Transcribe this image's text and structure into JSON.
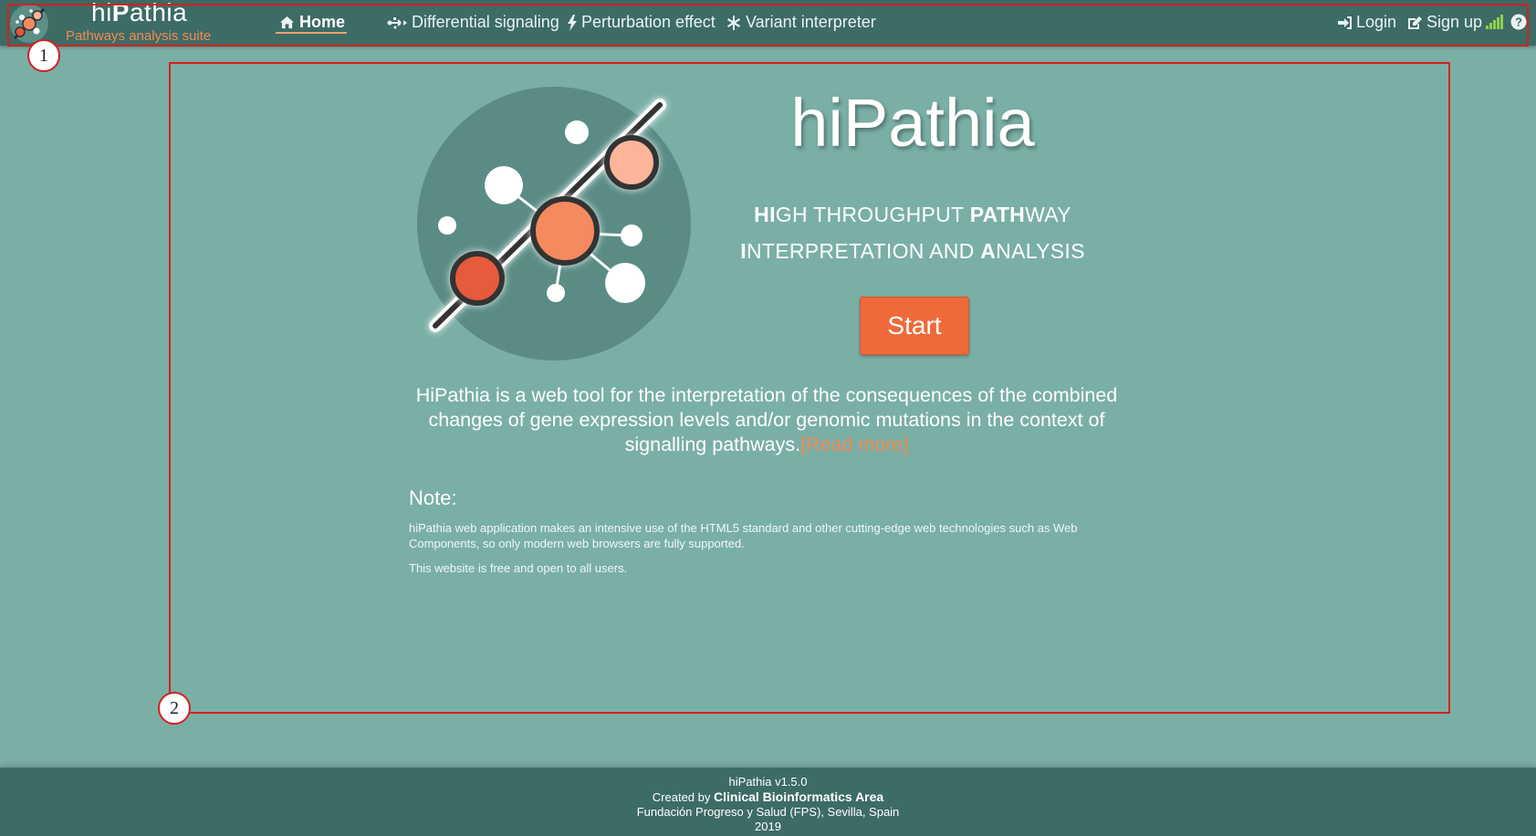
{
  "brand": {
    "title_prefix": "hi",
    "title_bold": "P",
    "title_suffix": "athia",
    "subtitle": "Pathways analysis suite"
  },
  "nav": {
    "home": "Home",
    "differential": "Differential signaling",
    "perturbation": "Perturbation effect",
    "variant": "Variant interpreter",
    "login": "Login",
    "signup": "Sign up"
  },
  "annotations": {
    "one": "1",
    "two": "2"
  },
  "hero": {
    "title_prefix": "hi",
    "title_bold": "P",
    "title_suffix": "athia",
    "line1": [
      {
        "t": "HI",
        "b": true
      },
      {
        "t": "GH THROUGHPUT ",
        "b": false
      },
      {
        "t": "PATH",
        "b": true
      },
      {
        "t": "WAY",
        "b": false
      }
    ],
    "line2": [
      {
        "t": "I",
        "b": true
      },
      {
        "t": "NTERPRETATION AND ",
        "b": false
      },
      {
        "t": "A",
        "b": true
      },
      {
        "t": "NALYSIS",
        "b": false
      }
    ],
    "start": "Start",
    "description": "HiPathia is a web tool for the interpretation of the consequences of the combined changes of gene expression levels and/or genomic mutations in the context of signalling pathways.",
    "read_more": "[Read more]"
  },
  "note": {
    "title": "Note:",
    "text1": "hiPathia web application makes an intensive use of the HTML5 standard and other cutting-edge web technologies such as Web Components, so only modern web browsers are fully supported.",
    "text2": "This website is free and open to all users."
  },
  "footer": {
    "version": "hiPathia v1.5.0",
    "created_by": "Created by",
    "org": "Clinical Bioinformatics Area",
    "foundation": "Fundación Progreso y Salud (FPS), Sevilla, Spain",
    "year": "2019"
  },
  "colors": {
    "background": "#7aafa6",
    "navbar": "#3d6b65",
    "accent": "#ee6a3a",
    "annotation": "#d42020"
  }
}
